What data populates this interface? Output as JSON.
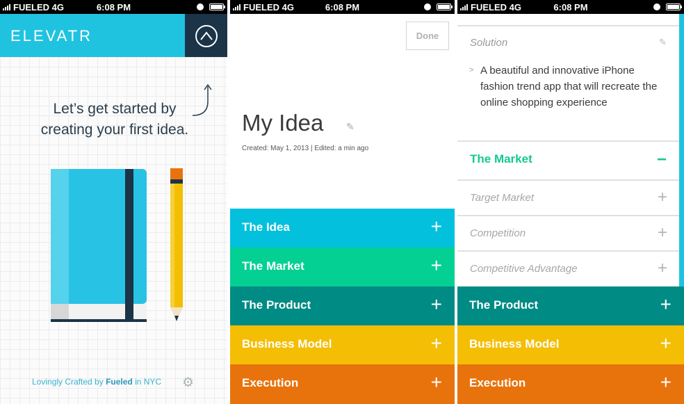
{
  "status_bar": {
    "carrier": "FUELED 4G",
    "time": "6:08 PM"
  },
  "screen1": {
    "logo": "ELEVATR",
    "tagline_line1": "Let’s get started by",
    "tagline_line2": "creating your first idea.",
    "footer_prefix": "Lovingly Crafted by",
    "footer_brand": "Fueled",
    "footer_suffix": "in NYC",
    "colors": {
      "header": "#1fc3e0",
      "dark": "#1b3447",
      "notebook": "#28c2e4"
    }
  },
  "screen2": {
    "done_label": "Done",
    "title": "My Idea",
    "meta": "Created: May 1, 2013 | Edited: a min ago",
    "sections": [
      {
        "label": "The Idea",
        "color": "#03c1dd"
      },
      {
        "label": "The Market",
        "color": "#05d093"
      },
      {
        "label": "The Product",
        "color": "#008b85"
      },
      {
        "label": "Business Model",
        "color": "#f4be05"
      },
      {
        "label": "Execution",
        "color": "#e8730d"
      }
    ]
  },
  "screen3": {
    "solution_label": "Solution",
    "solution_text": "A beautiful and innovative iPhone fashion trend app that will recreate the online shopping experience",
    "market_heading": "The Market",
    "subsections": [
      "Target Market",
      "Competition",
      "Competitive Advantage"
    ],
    "sections": [
      {
        "label": "The Product",
        "color": "#008b85"
      },
      {
        "label": "Business Model",
        "color": "#f4be05"
      },
      {
        "label": "Execution",
        "color": "#e8730d"
      }
    ]
  }
}
